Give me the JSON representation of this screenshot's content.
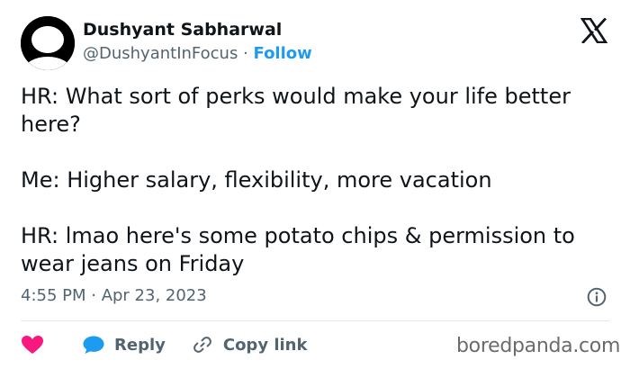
{
  "author": {
    "display_name": "Dushyant Sabharwal",
    "handle": "@DushyantInFocus",
    "separator": " · ",
    "follow_label": "Follow"
  },
  "tweet": {
    "text": "HR: What sort of perks would make your life better here?\n\nMe: Higher salary, flexibility, more vacation\n\nHR: lmao here's some potato chips & permission to wear jeans on Friday",
    "timestamp": "4:55 PM · Apr 23, 2023"
  },
  "actions": {
    "reply_label": "Reply",
    "copy_link_label": "Copy link"
  },
  "watermark": {
    "text": "boredpanda.com"
  },
  "icons": {
    "logo": "x-logo-icon",
    "like": "heart-icon",
    "reply": "speech-bubble-icon",
    "copy": "link-icon",
    "info": "info-icon"
  },
  "colors": {
    "accent": "#1d9bf0",
    "like": "#f91880",
    "text": "#0f1419",
    "secondary": "#536471"
  }
}
